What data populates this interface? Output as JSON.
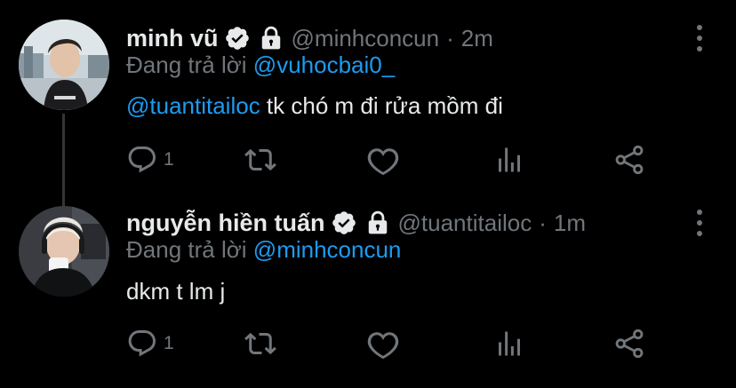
{
  "colors": {
    "background": "#000000",
    "text_primary": "#e7e9ea",
    "text_secondary": "#71767b",
    "accent_link": "#1d9bf0",
    "thread_line": "#333639"
  },
  "tweets": [
    {
      "display_name": "minh vũ",
      "handle": "@minhconcun",
      "separator": "·",
      "time": "2m",
      "verified_icon": "verified-badge-icon",
      "protected_icon": "lock-icon",
      "replying_prefix": "Đang trả lời",
      "replying_to": "@vuhocbai0_",
      "body_mention": "@tuantitailoc",
      "body_text": " tk chó m đi rửa mồm đi",
      "reply_count": "1",
      "retweet_count": "",
      "like_count": ""
    },
    {
      "display_name": "nguyễn hiền tuấn",
      "handle": "@tuantitailoc",
      "separator": "·",
      "time": "1m",
      "verified_icon": "verified-badge-icon",
      "protected_icon": "lock-icon",
      "replying_prefix": "Đang trả lời",
      "replying_to": "@minhconcun",
      "body_mention": "",
      "body_text": "dkm t lm j",
      "reply_count": "1",
      "retweet_count": "",
      "like_count": ""
    }
  ]
}
